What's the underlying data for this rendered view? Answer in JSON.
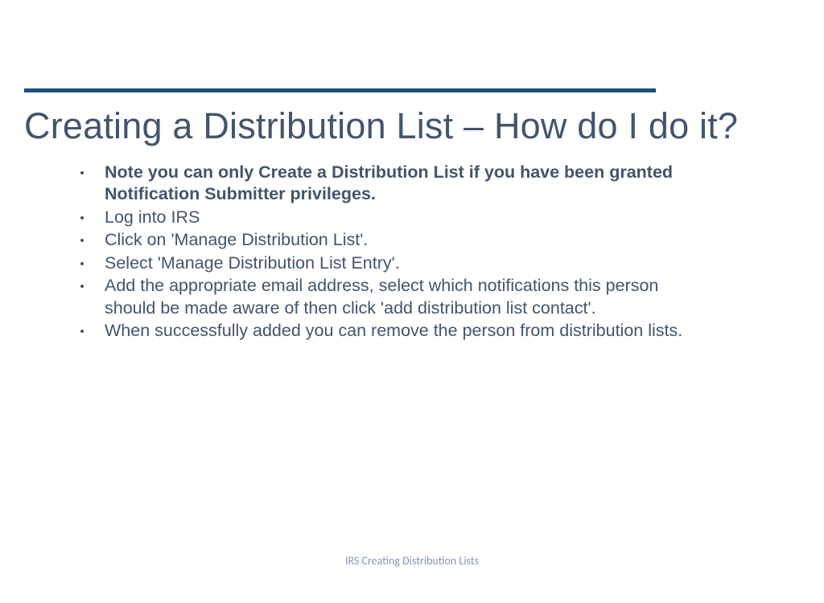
{
  "title": "Creating a Distribution List – How do I do it?",
  "bullets": [
    {
      "text": "Note you can only Create a Distribution List if you have been granted Notification Submitter privileges.",
      "bold": true
    },
    {
      "text": "Log into IRS",
      "bold": false
    },
    {
      "text": "Click on 'Manage Distribution List'.",
      "bold": false
    },
    {
      "text": "Select 'Manage Distribution List Entry'.",
      "bold": false
    },
    {
      "text": "Add the appropriate email address, select which notifications this person should be made aware of then click 'add distribution list contact'.",
      "bold": false
    },
    {
      "text": "When successfully added you can remove the person from distribution lists.",
      "bold": false
    }
  ],
  "footer": "IRS Creating Distribution Lists",
  "colors": {
    "divider": "#1f4e79",
    "text": "#44546a",
    "footer": "#8496b0"
  }
}
